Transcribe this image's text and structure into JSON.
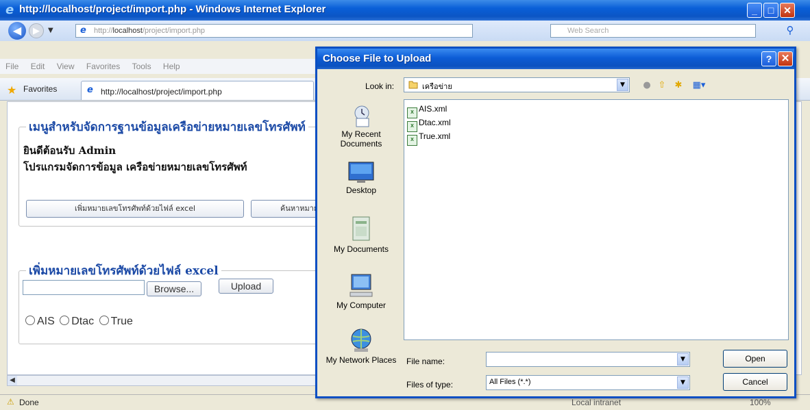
{
  "browser": {
    "title": "http://localhost/project/import.php - Windows Internet Explorer",
    "address_prefix": "http://",
    "address_host": "localhost",
    "address_path": "/project/import.php",
    "search_placeholder": "Web Search",
    "menu": [
      "File",
      "Edit",
      "View",
      "Favorites",
      "Tools",
      "Help"
    ],
    "favorites_label": "Favorites",
    "tab_title": "http://localhost/project/import.php",
    "status": "Done",
    "zone": "Local intranet",
    "zoom": "100%"
  },
  "page": {
    "menu_legend": "เมนูสำหรับจัดการฐานข้อมูลเครือข่ายหมายเลขโทรศัพท์",
    "welcome": "ยินดีต้อนรับ Admin",
    "program_title": "โปรแกรมจัดการข้อมูล เครือข่ายหมายเลขโทรศัพท์",
    "button_add_excel": "เพิ่มหมายเลขโทรศัพท์ด้วยไฟล์ excel",
    "button_search": "ค้นหาหมายเลขโทรศัพท์",
    "upload_legend": "เพิ่มหมายเลขโทรศัพท์ด้วยไฟล์ excel",
    "browse_label": "Browse...",
    "upload_label": "Upload",
    "radio_options": [
      "AIS",
      "Dtac",
      "True"
    ]
  },
  "dialog": {
    "title": "Choose File to Upload",
    "look_in_label": "Look in:",
    "look_in_value": "เครือข่าย",
    "places": [
      "My Recent Documents",
      "Desktop",
      "My Documents",
      "My Computer",
      "My Network Places"
    ],
    "files": [
      "AIS.xml",
      "Dtac.xml",
      "True.xml"
    ],
    "file_name_label": "File name:",
    "file_name_value": "",
    "files_of_type_label": "Files of type:",
    "files_of_type_value": "All Files (*.*)",
    "open_label": "Open",
    "cancel_label": "Cancel",
    "help_glyph": "?",
    "close_glyph": "✕"
  }
}
